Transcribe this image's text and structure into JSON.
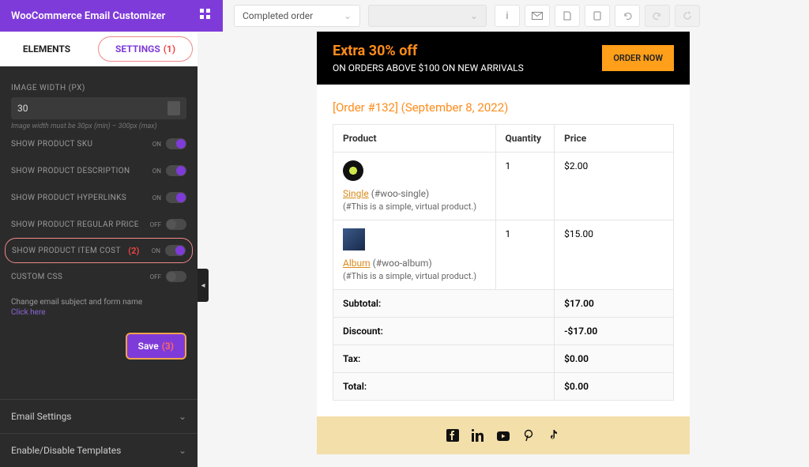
{
  "brand": "WooCommerce Email Customizer",
  "top": {
    "email_type": "Completed order",
    "tooltip_icons": [
      "info",
      "mail",
      "copy",
      "trash",
      "undo",
      "redo",
      "refresh"
    ]
  },
  "tabs": {
    "elements": "ELEMENTS",
    "settings": "SETTINGS"
  },
  "annotations": {
    "one": "(1)",
    "two": "(2)",
    "three": "(3)"
  },
  "settings": {
    "image_width_label": "IMAGE WIDTH (PX)",
    "image_width_value": "30",
    "image_width_hint": "Image width must be 30px (min) – 300px (max)",
    "toggles": [
      {
        "label": "SHOW PRODUCT SKU",
        "state": "ON",
        "on": true,
        "hl": false
      },
      {
        "label": "SHOW PRODUCT DESCRIPTION",
        "state": "ON",
        "on": true,
        "hl": false
      },
      {
        "label": "SHOW PRODUCT HYPERLINKS",
        "state": "ON",
        "on": true,
        "hl": false
      },
      {
        "label": "SHOW PRODUCT REGULAR PRICE",
        "state": "OFF",
        "on": false,
        "hl": false
      },
      {
        "label": "SHOW PRODUCT ITEM COST",
        "state": "ON",
        "on": true,
        "hl": true
      },
      {
        "label": "CUSTOM CSS",
        "state": "OFF",
        "on": false,
        "hl": false
      }
    ],
    "note": "Change email subject and form name",
    "link": "Click here",
    "save": "Save"
  },
  "accordions": [
    "Email Settings",
    "Enable/Disable Templates"
  ],
  "email": {
    "banner_title": "Extra 30% off",
    "banner_sub": "ON ORDERS ABOVE $100 ON NEW ARRIVALS",
    "banner_cta": "ORDER NOW",
    "order_header": "[Order #132] (September 8, 2022)",
    "cols": {
      "product": "Product",
      "qty": "Quantity",
      "price": "Price"
    },
    "items": [
      {
        "name": "Single",
        "sku": "(#woo-single)",
        "desc": "(#This is a simple, virtual product.)",
        "qty": "1",
        "price": "$2.00",
        "img": "vinyl"
      },
      {
        "name": "Album",
        "sku": "(#woo-album)",
        "desc": "(#This is a simple, virtual product.)",
        "qty": "1",
        "price": "$15.00",
        "img": "thumb"
      }
    ],
    "totals": [
      {
        "label": "Subtotal:",
        "value": "$17.00"
      },
      {
        "label": "Discount:",
        "value": "-$17.00"
      },
      {
        "label": "Tax:",
        "value": "$0.00"
      },
      {
        "label": "Total:",
        "value": "$0.00"
      }
    ]
  }
}
